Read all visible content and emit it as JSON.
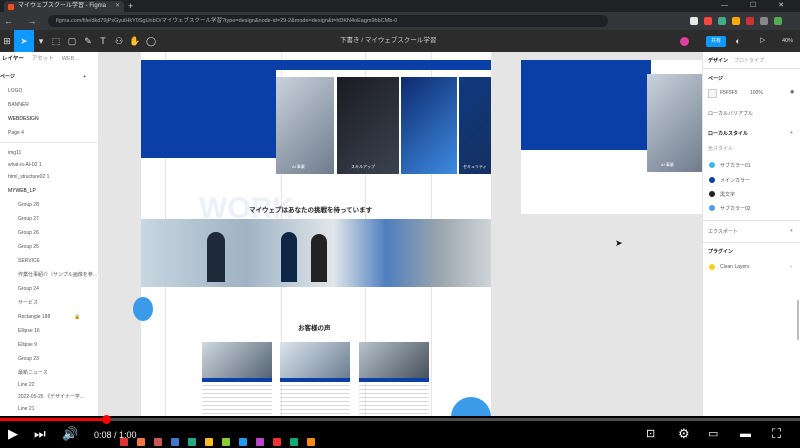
{
  "browser": {
    "tab_title": "マイウェブスクール学習 - Figma",
    "new_tab": "+",
    "window_controls": "— ☐ ✕",
    "nav": "← → ↻",
    "url": "figma.com/file/dkd79jPxGyuiHkY0SgUnbO/マイウェブスクール学習?type=design&node-id=29-2&mode=design&t=hDKN4oEagm9bbCMb-0"
  },
  "figma": {
    "file_title": "下書き / マイウェブスクール学習",
    "share_label": "共有",
    "zoom": "40%",
    "play": "▷",
    "tools": [
      "▾",
      "⬚",
      "▢",
      "✎",
      "T",
      "⚇",
      "✋",
      "◯"
    ]
  },
  "left_panel": {
    "tabs": [
      "レイヤー",
      "アセット",
      "WEB..."
    ],
    "pages_header": "ページ",
    "pages": [
      "LOGO",
      "BANNER",
      "WEBDESIGN",
      "Page 4"
    ],
    "layers": [
      "img11",
      "what-is-AI-02 1",
      "html_structure02 1",
      "MYWEB_LP",
      "Group 28",
      "Group 27",
      "Group 26",
      "Group 25",
      "SERVICE",
      "作業仕事紹介（サンプル画像を参...",
      "Group 24",
      "サービス",
      "Rectangle 188",
      "Ellipse 16",
      "Ellipse 9",
      "Group 23",
      "最新ニュース",
      "Line 22",
      "2022-05-25 《デザイナー学...",
      "Line 21",
      "2022-05-25 プログラミン..."
    ]
  },
  "canvas": {
    "section_work_heading": "マイウェブはあなたの挑戦を待っています",
    "work_watermark": "WORK",
    "voice_heading": "お客様の声",
    "thumb_labels": [
      "AI 事業",
      "スキルアップ",
      "セキュリティ"
    ],
    "right_thumb_label": "AI 事業"
  },
  "right_panel": {
    "tabs": [
      "デザイン",
      "プロトタイプ"
    ],
    "page_header": "ページ",
    "page_color": "F5F5F5",
    "page_opacity": "100%",
    "local_vars": "ローカルバリアブル",
    "local_styles": "ローカルスタイル",
    "color_styles_header": "色スタイル",
    "styles": [
      {
        "name": "サブカラー01",
        "color": "#3cb8e8"
      },
      {
        "name": "メインカラー",
        "color": "#0a3fa8"
      },
      {
        "name": "黒文字",
        "color": "#222222"
      },
      {
        "name": "サブカラー02",
        "color": "#4aa0e0"
      }
    ],
    "export": "エクスポート",
    "plugins": "プラグイン",
    "plugin_name": "Clean Layers"
  },
  "player": {
    "time": "0:08 / 1:00",
    "progress": 0.133
  }
}
